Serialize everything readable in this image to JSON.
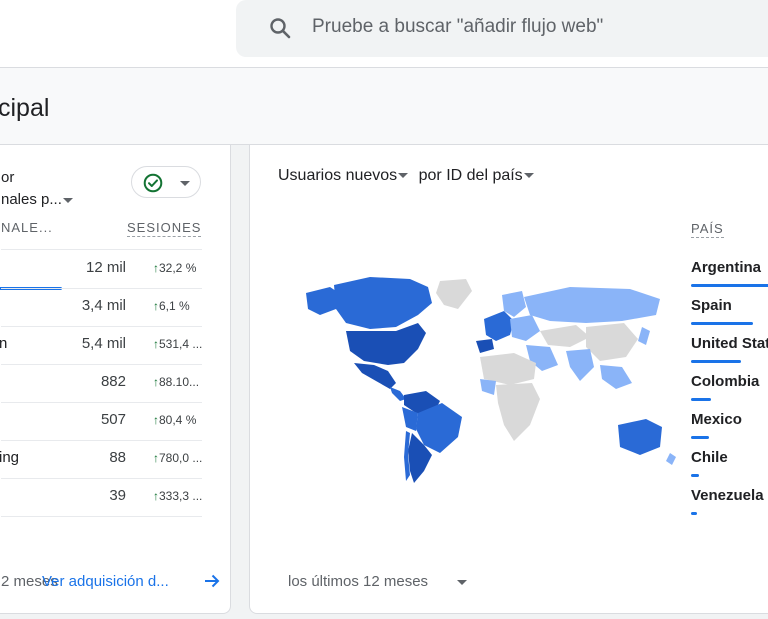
{
  "search": {
    "placeholder": "Pruebe a buscar \"añadir flujo web\"",
    "icon": "search-icon"
  },
  "page": {
    "title": "cipal"
  },
  "left_card": {
    "dimension_line1": "or",
    "dimension_line2": "nales p...",
    "status_icon": "check-circle-icon",
    "col_channel": "NALE...",
    "col_sessions": "SESIONES",
    "rows": [
      {
        "label": "",
        "value": "12 mil",
        "change": "32,2 %",
        "share": 0.9
      },
      {
        "label": "",
        "value": "3,4 mil",
        "change": "6,1 %",
        "share": 0.0
      },
      {
        "label": "n",
        "value": "5,4 mil",
        "change": "531,4 ...",
        "share": 0.0
      },
      {
        "label": "",
        "value": "882",
        "change": "88.10...",
        "share": 0.0
      },
      {
        "label": "",
        "value": "507",
        "change": "80,4 %",
        "share": 0.0
      },
      {
        "label": "ing",
        "value": "88",
        "change": "780,0 ...",
        "share": 0.0
      },
      {
        "label": "",
        "value": "39",
        "change": "333,3 ...",
        "share": 0.0
      }
    ],
    "footer_period": "2 meses",
    "footer_link": "Ver adquisición d..."
  },
  "right_card": {
    "metric": "Usuarios nuevos",
    "dimension": "por ID del país",
    "col_country": "PAÍS",
    "countries": [
      {
        "name": "Argentina",
        "share": 1.0
      },
      {
        "name": "Spain",
        "share": 0.62
      },
      {
        "name": "United Stat",
        "share": 0.5
      },
      {
        "name": "Colombia",
        "share": 0.2
      },
      {
        "name": "Mexico",
        "share": 0.18
      },
      {
        "name": "Chile",
        "share": 0.08
      },
      {
        "name": "Venezuela",
        "share": 0.06
      }
    ],
    "period": "los últimos 12 meses"
  },
  "colors": {
    "accent": "#1a73e8",
    "positive": "#137333",
    "map_dark": "#1a4fb5",
    "map_mid": "#2a6ad6",
    "map_light": "#8ab4f8",
    "map_gray": "#d9d9d9"
  }
}
